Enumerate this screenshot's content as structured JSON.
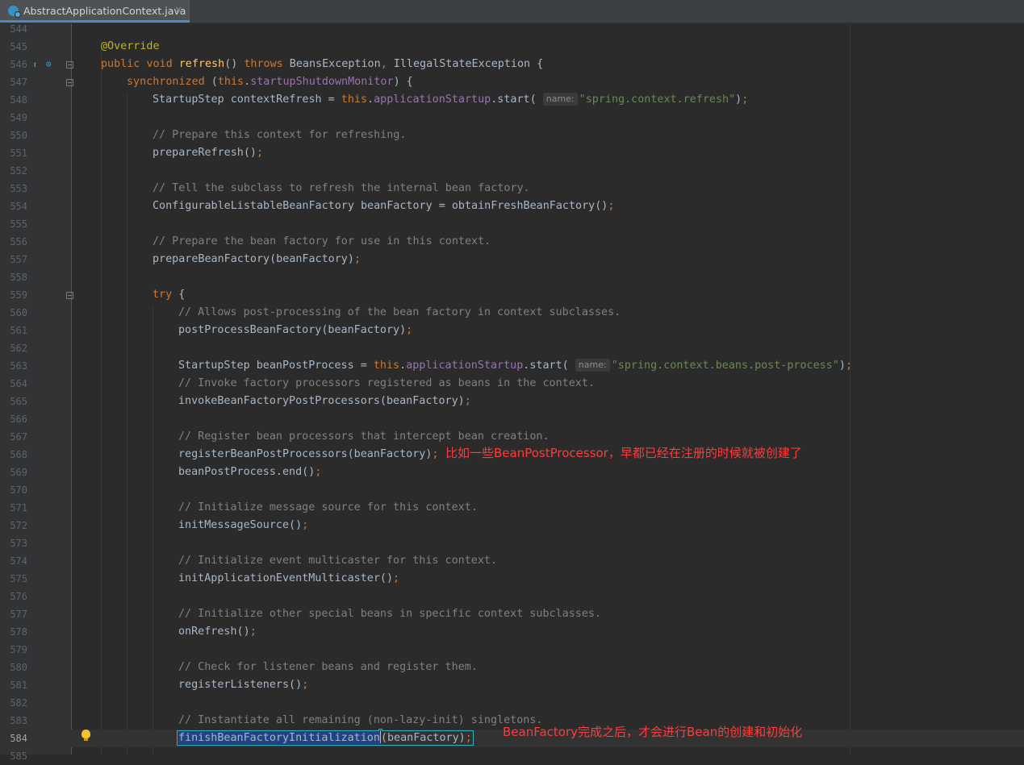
{
  "tab": {
    "title": "AbstractApplicationContext.java",
    "close": "×",
    "icon": "java-class-icon"
  },
  "gutter_icons": {
    "line_546": [
      "override-method-icon",
      "implemented-icon"
    ],
    "line_584": "lightbulb-icon"
  },
  "lines": [
    {
      "n": "544",
      "code": ""
    },
    {
      "n": "545",
      "code": "@Override"
    },
    {
      "n": "546",
      "code": "public void refresh() throws BeansException, IllegalStateException {"
    },
    {
      "n": "547",
      "code": "synchronized (this.startupShutdownMonitor) {"
    },
    {
      "n": "548",
      "code": "StartupStep contextRefresh = this.applicationStartup.start( name: \"spring.context.refresh\");"
    },
    {
      "n": "549",
      "code": ""
    },
    {
      "n": "550",
      "code": "// Prepare this context for refreshing."
    },
    {
      "n": "551",
      "code": "prepareRefresh();"
    },
    {
      "n": "552",
      "code": ""
    },
    {
      "n": "553",
      "code": "// Tell the subclass to refresh the internal bean factory."
    },
    {
      "n": "554",
      "code": "ConfigurableListableBeanFactory beanFactory = obtainFreshBeanFactory();"
    },
    {
      "n": "555",
      "code": ""
    },
    {
      "n": "556",
      "code": "// Prepare the bean factory for use in this context."
    },
    {
      "n": "557",
      "code": "prepareBeanFactory(beanFactory);"
    },
    {
      "n": "558",
      "code": ""
    },
    {
      "n": "559",
      "code": "try {"
    },
    {
      "n": "560",
      "code": "// Allows post-processing of the bean factory in context subclasses."
    },
    {
      "n": "561",
      "code": "postProcessBeanFactory(beanFactory);"
    },
    {
      "n": "562",
      "code": ""
    },
    {
      "n": "563",
      "code": "StartupStep beanPostProcess = this.applicationStartup.start( name: \"spring.context.beans.post-process\");"
    },
    {
      "n": "564",
      "code": "// Invoke factory processors registered as beans in the context."
    },
    {
      "n": "565",
      "code": "invokeBeanFactoryPostProcessors(beanFactory);"
    },
    {
      "n": "566",
      "code": ""
    },
    {
      "n": "567",
      "code": "// Register bean processors that intercept bean creation."
    },
    {
      "n": "568",
      "code": "registerBeanPostProcessors(beanFactory);"
    },
    {
      "n": "569",
      "code": "beanPostProcess.end();"
    },
    {
      "n": "570",
      "code": ""
    },
    {
      "n": "571",
      "code": "// Initialize message source for this context."
    },
    {
      "n": "572",
      "code": "initMessageSource();"
    },
    {
      "n": "573",
      "code": ""
    },
    {
      "n": "574",
      "code": "// Initialize event multicaster for this context."
    },
    {
      "n": "575",
      "code": "initApplicationEventMulticaster();"
    },
    {
      "n": "576",
      "code": ""
    },
    {
      "n": "577",
      "code": "// Initialize other special beans in specific context subclasses."
    },
    {
      "n": "578",
      "code": "onRefresh();"
    },
    {
      "n": "579",
      "code": ""
    },
    {
      "n": "580",
      "code": "// Check for listener beans and register them."
    },
    {
      "n": "581",
      "code": "registerListeners();"
    },
    {
      "n": "582",
      "code": ""
    },
    {
      "n": "583",
      "code": "// Instantiate all remaining (non-lazy-init) singletons."
    },
    {
      "n": "584",
      "code": "finishBeanFactoryInitialization(beanFactory);"
    },
    {
      "n": "585",
      "code": ""
    }
  ],
  "annotations": {
    "note_568": "比如一些BeanPostProcessor，早都已经在注册的时候就被创建了",
    "note_584": "BeanFactory完成之后，才会进行Bean的创建和初始化"
  },
  "colors": {
    "background": "#2b2b2b",
    "keyword": "#cc7832",
    "annotation": "#bbb529",
    "field": "#9876aa",
    "method_decl": "#ffc66d",
    "string": "#6a8759",
    "comment": "#808080",
    "note": "#ff3b3b",
    "selection": "#214283"
  }
}
